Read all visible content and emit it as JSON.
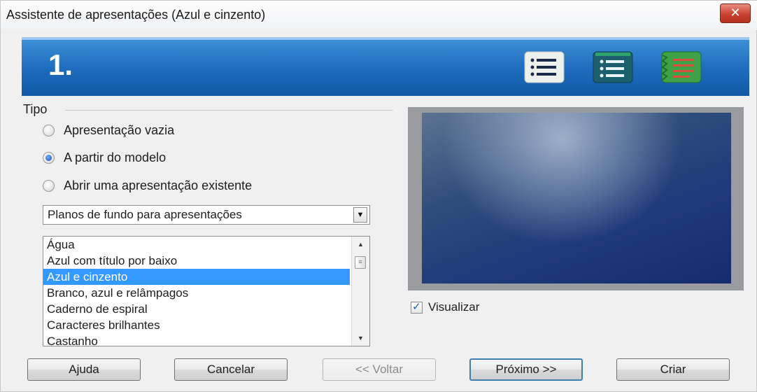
{
  "window": {
    "title": "Assistente de apresentações (Azul e cinzento)",
    "close_label": "✕"
  },
  "banner": {
    "step": "1.",
    "icons": [
      "list-icon",
      "list-icon-teal",
      "list-icon-green"
    ]
  },
  "type_group": {
    "label": "Tipo",
    "options": [
      {
        "label": "Apresentação vazia",
        "checked": false
      },
      {
        "label": "A partir do modelo",
        "checked": true
      },
      {
        "label": "Abrir uma apresentação existente",
        "checked": false
      }
    ]
  },
  "category_select": {
    "value": "Planos de fundo para apresentações"
  },
  "template_list": {
    "items": [
      "Água",
      "Azul com título por baixo",
      "Azul e cinzento",
      "Branco, azul e relâmpagos",
      "Caderno de espiral",
      "Caracteres brilhantes",
      "Castanho"
    ],
    "selected_index": 2
  },
  "preview": {
    "checkbox_label": "Visualizar",
    "checked": true
  },
  "buttons": {
    "help": "Ajuda",
    "cancel": "Cancelar",
    "back": "<< Voltar",
    "next": "Próximo >>",
    "create": "Criar"
  },
  "colors": {
    "banner": "#1e6dbe",
    "selection": "#3399ff",
    "close": "#c94332"
  }
}
